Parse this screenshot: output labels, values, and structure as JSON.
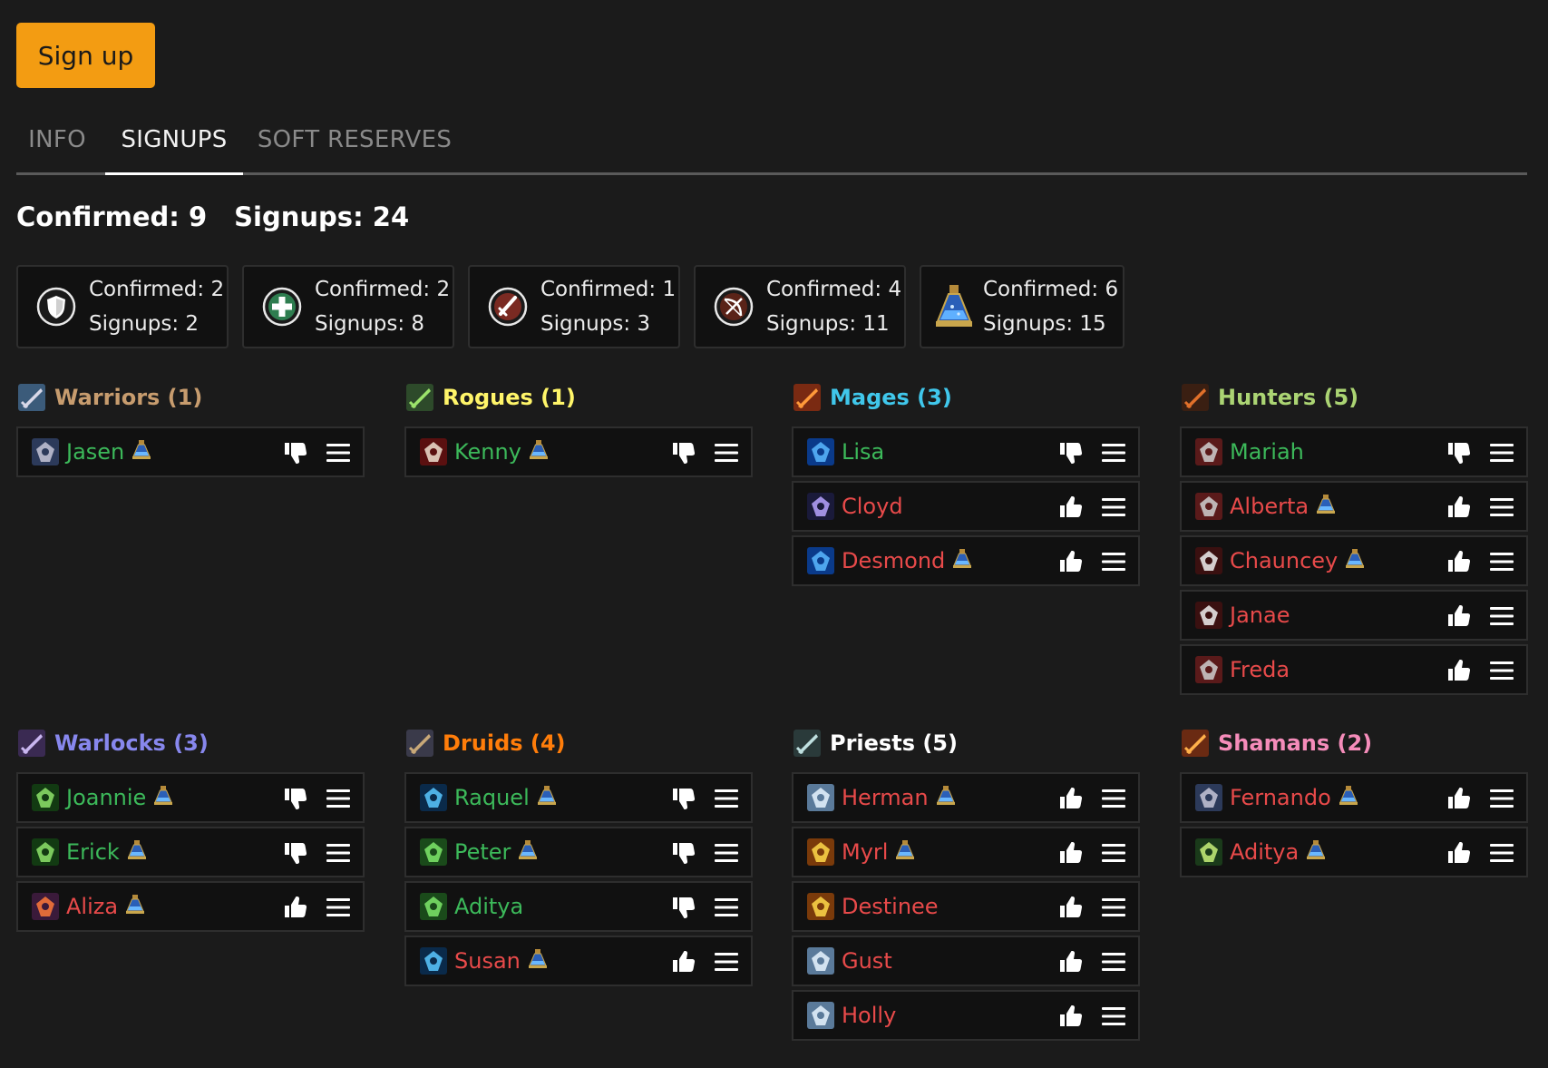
{
  "signup_button": "Sign up",
  "tabs": [
    {
      "label": "INFO",
      "active": false
    },
    {
      "label": "SIGNUPS",
      "active": true
    },
    {
      "label": "SOFT RESERVES",
      "active": false
    }
  ],
  "totals": {
    "confirmed": "Confirmed: 9",
    "signups": "Signups: 24"
  },
  "roles": [
    {
      "icon": "tank-shield-icon",
      "confirmed": "Confirmed: 2",
      "signups": "Signups: 2"
    },
    {
      "icon": "healer-cross-icon",
      "confirmed": "Confirmed: 2",
      "signups": "Signups: 8"
    },
    {
      "icon": "melee-sword-icon",
      "confirmed": "Confirmed: 1",
      "signups": "Signups: 3"
    },
    {
      "icon": "ranged-bow-icon",
      "confirmed": "Confirmed: 4",
      "signups": "Signups: 11"
    },
    {
      "icon": "flask-icon",
      "confirmed": "Confirmed: 6",
      "signups": "Signups: 15"
    }
  ],
  "colors": {
    "confirmed_name": "#3cb95a",
    "unconfirmed_name": "#e84a4a",
    "accent": "#f39c12"
  },
  "classes": [
    {
      "name": "Warriors (1)",
      "color": "#c79c6e",
      "icon": "warrior-sword-icon",
      "players": [
        {
          "name": "Jasen",
          "confirmed": true,
          "flask": true,
          "spec_icon": "shield-spec-icon"
        }
      ]
    },
    {
      "name": "Rogues (1)",
      "color": "#fff569",
      "icon": "rogue-daggers-icon",
      "players": [
        {
          "name": "Kenny",
          "confirmed": true,
          "flask": true,
          "spec_icon": "combat-spec-icon"
        }
      ]
    },
    {
      "name": "Mages (3)",
      "color": "#40c7eb",
      "icon": "mage-staff-icon",
      "players": [
        {
          "name": "Lisa",
          "confirmed": true,
          "flask": false,
          "spec_icon": "arcane-spec-icon"
        },
        {
          "name": "Cloyd",
          "confirmed": false,
          "flask": false,
          "spec_icon": "frost-spec-icon"
        },
        {
          "name": "Desmond",
          "confirmed": false,
          "flask": true,
          "spec_icon": "arcane-spec-icon"
        }
      ]
    },
    {
      "name": "Hunters (5)",
      "color": "#abd473",
      "icon": "hunter-bow-icon",
      "players": [
        {
          "name": "Mariah",
          "confirmed": true,
          "flask": false,
          "spec_icon": "beast-spec-icon"
        },
        {
          "name": "Alberta",
          "confirmed": false,
          "flask": true,
          "spec_icon": "beast-spec-icon"
        },
        {
          "name": "Chauncey",
          "confirmed": false,
          "flask": true,
          "spec_icon": "marksman-spec-icon"
        },
        {
          "name": "Janae",
          "confirmed": false,
          "flask": false,
          "spec_icon": "marksman-spec-icon"
        },
        {
          "name": "Freda",
          "confirmed": false,
          "flask": false,
          "spec_icon": "beast-spec-icon"
        }
      ]
    },
    {
      "name": "Warlocks (3)",
      "color": "#8787ed",
      "icon": "warlock-demon-icon",
      "players": [
        {
          "name": "Joannie",
          "confirmed": true,
          "flask": true,
          "spec_icon": "affliction-spec-icon"
        },
        {
          "name": "Erick",
          "confirmed": true,
          "flask": true,
          "spec_icon": "affliction-spec-icon"
        },
        {
          "name": "Aliza",
          "confirmed": false,
          "flask": true,
          "spec_icon": "demonology-spec-icon"
        }
      ]
    },
    {
      "name": "Druids (4)",
      "color": "#ff7d0a",
      "icon": "druid-paw-icon",
      "players": [
        {
          "name": "Raquel",
          "confirmed": true,
          "flask": true,
          "spec_icon": "feral-spec-icon"
        },
        {
          "name": "Peter",
          "confirmed": true,
          "flask": true,
          "spec_icon": "restoration-spec-icon"
        },
        {
          "name": "Aditya",
          "confirmed": true,
          "flask": false,
          "spec_icon": "restoration-spec-icon"
        },
        {
          "name": "Susan",
          "confirmed": false,
          "flask": true,
          "spec_icon": "feral-spec-icon"
        }
      ]
    },
    {
      "name": "Priests (5)",
      "color": "#ffffff",
      "icon": "priest-staff-icon",
      "players": [
        {
          "name": "Herman",
          "confirmed": false,
          "flask": true,
          "spec_icon": "holy-spec-icon"
        },
        {
          "name": "Myrl",
          "confirmed": false,
          "flask": true,
          "spec_icon": "nova-spec-icon"
        },
        {
          "name": "Destinee",
          "confirmed": false,
          "flask": false,
          "spec_icon": "nova-spec-icon"
        },
        {
          "name": "Gust",
          "confirmed": false,
          "flask": false,
          "spec_icon": "holy-spec-icon"
        },
        {
          "name": "Holly",
          "confirmed": false,
          "flask": false,
          "spec_icon": "holy-spec-icon"
        }
      ]
    },
    {
      "name": "Shamans (2)",
      "color": "#f58cba",
      "icon": "shaman-totem-icon",
      "players": [
        {
          "name": "Fernando",
          "confirmed": false,
          "flask": true,
          "spec_icon": "shield-spec-icon"
        },
        {
          "name": "Aditya",
          "confirmed": false,
          "flask": true,
          "spec_icon": "enhancement-spec-icon"
        }
      ]
    }
  ]
}
